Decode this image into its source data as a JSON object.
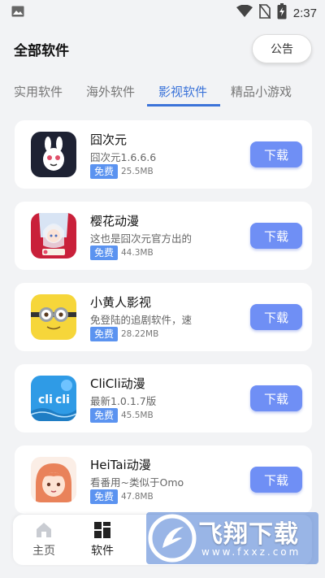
{
  "status_bar": {
    "time": "2:37"
  },
  "header": {
    "title": "全部软件",
    "notice_label": "公告"
  },
  "tabs": [
    {
      "label": "实用软件",
      "active": false
    },
    {
      "label": "海外软件",
      "active": false
    },
    {
      "label": "影视软件",
      "active": true
    },
    {
      "label": "精品小游戏",
      "active": false
    }
  ],
  "apps": [
    {
      "name": "囧次元",
      "desc": "囧次元1.6.6.6",
      "badge": "免费",
      "size": "25.5MB",
      "button": "下载",
      "icon": "jiongciyuan-icon"
    },
    {
      "name": "樱花动漫",
      "desc": "这也是囧次元官方出的",
      "badge": "免费",
      "size": "44.3MB",
      "button": "下载",
      "icon": "sakura-anime-icon"
    },
    {
      "name": "小黄人影视",
      "desc": "免登陆的追剧软件，速",
      "badge": "免费",
      "size": "28.22MB",
      "button": "下载",
      "icon": "minion-icon"
    },
    {
      "name": "CliCli动漫",
      "desc": "最新1.0.1.7版",
      "badge": "免费",
      "size": "45.5MB",
      "button": "下载",
      "icon": "clicli-icon"
    },
    {
      "name": "HeiTai动漫",
      "desc": "看番用~类似于Omo",
      "badge": "免费",
      "size": "47.8MB",
      "button": "下载",
      "icon": "heitai-anime-icon"
    }
  ],
  "bottom_nav": [
    {
      "label": "主页",
      "icon": "home-icon"
    },
    {
      "label": "软件",
      "icon": "apps-grid-icon"
    }
  ],
  "watermark": {
    "title": "飞翔下载",
    "url": "www.fxxz.com"
  },
  "colors": {
    "accent": "#3b73d9",
    "button": "#6f8ff5",
    "badge": "#5b93f0",
    "background": "#f2f3f5"
  }
}
